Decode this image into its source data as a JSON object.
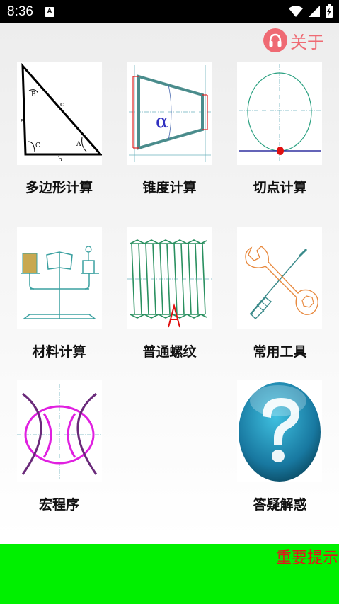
{
  "status_bar": {
    "time": "8:36",
    "notification_icon_letter": "A",
    "icons": [
      "notification-a-icon",
      "wifi-icon",
      "signal-icon",
      "battery-icon"
    ]
  },
  "header": {
    "about_label": "关于",
    "about_icon": "headphones-icon",
    "accent_color": "#ef6a73"
  },
  "tiles": [
    {
      "label": "多边形计算",
      "icon": "triangle-diagram-icon",
      "diagram_text": {
        "a": "a",
        "b": "b",
        "c": "c",
        "A": "A",
        "B": "B",
        "C": "C"
      }
    },
    {
      "label": "锥度计算",
      "icon": "taper-diagram-icon",
      "diagram_text": {
        "alpha": "α"
      }
    },
    {
      "label": "切点计算",
      "icon": "tangent-point-diagram-icon"
    },
    {
      "label": "材料计算",
      "icon": "material-balance-icon"
    },
    {
      "label": "普通螺纹",
      "icon": "thread-diagram-icon"
    },
    {
      "label": "常用工具",
      "icon": "wrench-screwdriver-icon"
    },
    {
      "label": "宏程序",
      "icon": "macro-program-diagram-icon"
    },
    {
      "label": "答疑解惑",
      "icon": "question-mark-icon"
    }
  ],
  "bottom_bar": {
    "marquee_text": "重要提示",
    "background_color": "#00f000",
    "text_color": "#e01818"
  }
}
